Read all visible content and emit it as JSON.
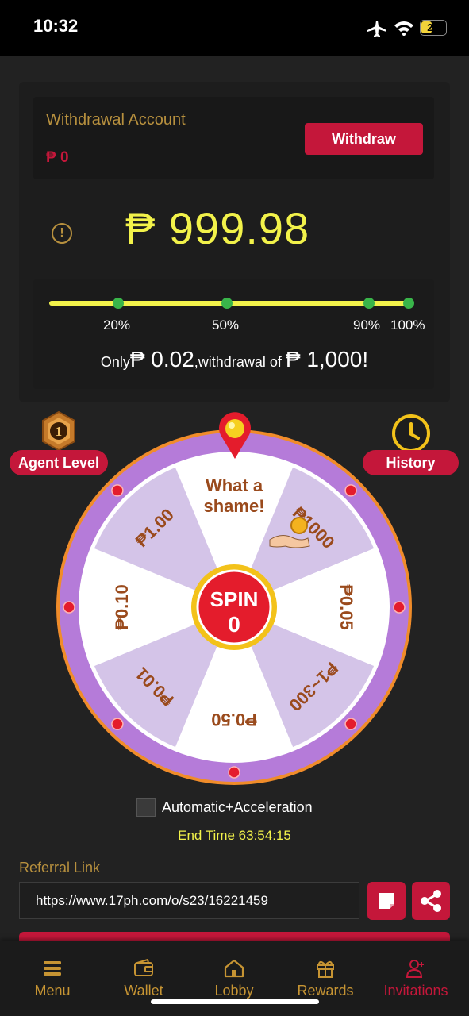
{
  "status_bar": {
    "time": "10:32",
    "battery": "25"
  },
  "account": {
    "title": "Withdrawal Account",
    "amount": "₱ 0",
    "withdraw_label": "Withdraw"
  },
  "balance": {
    "value": "₱ 999.98"
  },
  "progress": {
    "fraction": 0.9998,
    "markers": [
      "20%",
      "50%",
      "90%",
      "100%"
    ],
    "only_prefix": "Only",
    "only_amount": "₱ 0.02",
    "middle_text": ",withdrawal of ",
    "target_amount": "₱ 1,000",
    "suffix": "!"
  },
  "badges": {
    "agent_level": "Agent Level",
    "agent_level_number": "1",
    "history": "History"
  },
  "wheel": {
    "segments": [
      "What a shame!",
      "₱1000",
      "₱0.05",
      "₱1~300",
      "₱0.50",
      "₱0.01",
      "₱0.10",
      "₱1.00"
    ],
    "spin_label": "SPIN",
    "spin_count": "0"
  },
  "auto": {
    "label": "Automatic+Acceleration"
  },
  "end_time": {
    "text": "End Time 63:54:15"
  },
  "referral": {
    "label": "Referral Link",
    "url": "https://www.17ph.com/o/s23/16221459"
  },
  "nav": {
    "items": [
      {
        "label": "Menu",
        "icon": "menu-icon"
      },
      {
        "label": "Wallet",
        "icon": "wallet-icon"
      },
      {
        "label": "Lobby",
        "icon": "home-icon"
      },
      {
        "label": "Rewards",
        "icon": "gift-icon"
      },
      {
        "label": "Invitations",
        "icon": "invite-icon"
      }
    ],
    "active": "Invitations"
  },
  "colors": {
    "accent_red": "#c4173a",
    "gold": "#b7903e",
    "yellow": "#f2f24a",
    "wheel_purple": "#b57bd9"
  }
}
